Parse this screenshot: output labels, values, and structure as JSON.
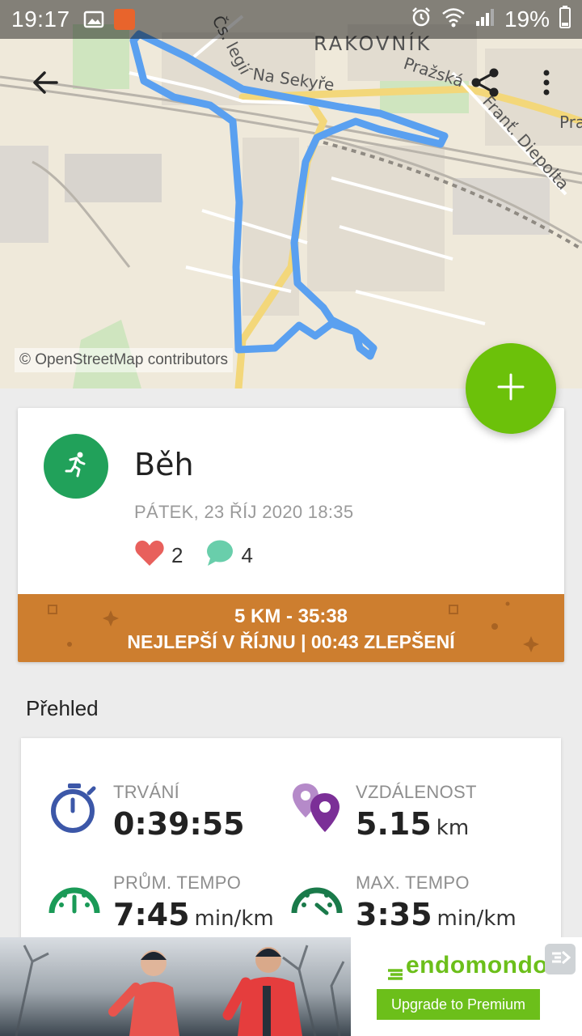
{
  "statusbar": {
    "time": "19:17",
    "battery": "19%",
    "icons": [
      "image-icon",
      "app-notification-icon",
      "alarm-icon",
      "wifi-icon",
      "signal-icon"
    ]
  },
  "map": {
    "place_labels": [
      "RAKOVNÍK",
      "Na Sekyře",
      "Pražská",
      "Franť. Diepolta",
      "Čs. legií",
      "Pra"
    ],
    "attribution": "© OpenStreetMap contributors",
    "route_color": "#5aa0f0"
  },
  "toolbar": {
    "back_icon": "arrow-back-icon",
    "share_icon": "share-icon",
    "more_icon": "more-vert-icon"
  },
  "fab": {
    "icon": "plus-icon",
    "color": "#6cc10a"
  },
  "workout": {
    "sport_icon": "running-icon",
    "title": "Běh",
    "date": "PÁTEK, 23 ŘÍJ 2020 18:35",
    "likes": "2",
    "comments": "4",
    "banner_line1": "5 KM  -  35:38",
    "banner_line2": "NEJLEPŠÍ V ŘÍJNU  |  00:43 ZLEPŠENÍ"
  },
  "overview": {
    "heading": "Přehled",
    "stats": [
      {
        "label": "TRVÁNÍ",
        "value": "0:39:55",
        "unit": "",
        "icon": "stopwatch-icon"
      },
      {
        "label": "VZDÁLENOST",
        "value": "5.15",
        "unit": "km",
        "icon": "location-pins-icon"
      },
      {
        "label": "PRŮM. TEMPO",
        "value": "7:45",
        "unit": "min/km",
        "icon": "speedometer-icon"
      },
      {
        "label": "MAX. TEMPO",
        "value": "3:35",
        "unit": "min/km",
        "icon": "speedometer-max-icon"
      }
    ]
  },
  "ad": {
    "brand": "endomondo",
    "cta": "Upgrade to Premium",
    "accent": "#6cbf1a"
  }
}
